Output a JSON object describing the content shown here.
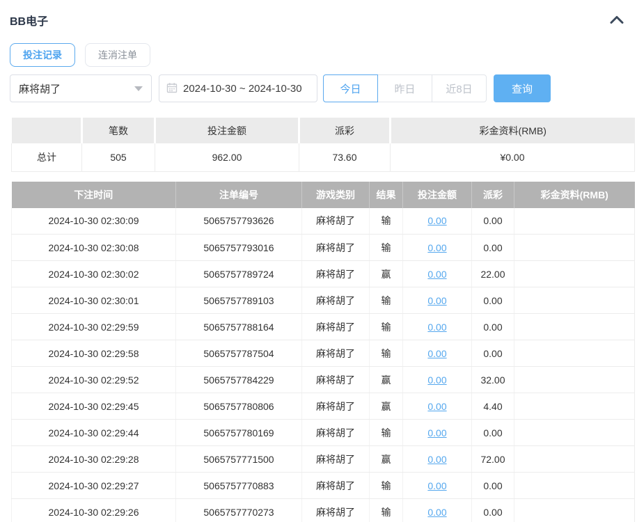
{
  "panel": {
    "title": "BB电子"
  },
  "tabs": [
    {
      "label": "投注记录",
      "active": true
    },
    {
      "label": "连消注单",
      "active": false
    }
  ],
  "filters": {
    "game_select": {
      "value": "麻将胡了"
    },
    "date_range": {
      "value": "2024-10-30 ~ 2024-10-30"
    },
    "quick_ranges": [
      {
        "label": "今日",
        "active": true
      },
      {
        "label": "昨日",
        "active": false
      },
      {
        "label": "近8日",
        "active": false
      }
    ],
    "search_label": "查询"
  },
  "summary": {
    "headers": [
      "",
      "笔数",
      "投注金额",
      "派彩",
      "彩金资料(RMB)"
    ],
    "row": {
      "label": "总计",
      "count": "505",
      "bet_amount": "962.00",
      "payout": "73.60",
      "bonus": "¥0.00"
    }
  },
  "table": {
    "headers": [
      "下注时间",
      "注单编号",
      "游戏类别",
      "结果",
      "投注金额",
      "派彩",
      "彩金资料(RMB)"
    ],
    "rows": [
      {
        "time": "2024-10-30 02:30:09",
        "order_no": "5065757793626",
        "game": "麻将胡了",
        "result": "输",
        "bet": "0.00",
        "payout": "0.00",
        "bonus": ""
      },
      {
        "time": "2024-10-30 02:30:08",
        "order_no": "5065757793016",
        "game": "麻将胡了",
        "result": "输",
        "bet": "0.00",
        "payout": "0.00",
        "bonus": ""
      },
      {
        "time": "2024-10-30 02:30:02",
        "order_no": "5065757789724",
        "game": "麻将胡了",
        "result": "赢",
        "bet": "0.00",
        "payout": "22.00",
        "bonus": ""
      },
      {
        "time": "2024-10-30 02:30:01",
        "order_no": "5065757789103",
        "game": "麻将胡了",
        "result": "输",
        "bet": "0.00",
        "payout": "0.00",
        "bonus": ""
      },
      {
        "time": "2024-10-30 02:29:59",
        "order_no": "5065757788164",
        "game": "麻将胡了",
        "result": "输",
        "bet": "0.00",
        "payout": "0.00",
        "bonus": ""
      },
      {
        "time": "2024-10-30 02:29:58",
        "order_no": "5065757787504",
        "game": "麻将胡了",
        "result": "输",
        "bet": "0.00",
        "payout": "0.00",
        "bonus": ""
      },
      {
        "time": "2024-10-30 02:29:52",
        "order_no": "5065757784229",
        "game": "麻将胡了",
        "result": "赢",
        "bet": "0.00",
        "payout": "32.00",
        "bonus": ""
      },
      {
        "time": "2024-10-30 02:29:45",
        "order_no": "5065757780806",
        "game": "麻将胡了",
        "result": "赢",
        "bet": "0.00",
        "payout": "4.40",
        "bonus": ""
      },
      {
        "time": "2024-10-30 02:29:44",
        "order_no": "5065757780169",
        "game": "麻将胡了",
        "result": "输",
        "bet": "0.00",
        "payout": "0.00",
        "bonus": ""
      },
      {
        "time": "2024-10-30 02:29:28",
        "order_no": "5065757771500",
        "game": "麻将胡了",
        "result": "赢",
        "bet": "0.00",
        "payout": "72.00",
        "bonus": ""
      },
      {
        "time": "2024-10-30 02:29:27",
        "order_no": "5065757770883",
        "game": "麻将胡了",
        "result": "输",
        "bet": "0.00",
        "payout": "0.00",
        "bonus": ""
      },
      {
        "time": "2024-10-30 02:29:26",
        "order_no": "5065757770273",
        "game": "麻将胡了",
        "result": "输",
        "bet": "0.00",
        "payout": "0.00",
        "bonus": ""
      }
    ]
  },
  "colors": {
    "accent_blue": "#5aa9ee",
    "search_button_bg": "#5fb0f2",
    "table_header_bg": "#b3b3b3",
    "summary_header_bg": "#ebebeb",
    "link_blue": "#54a7ee"
  }
}
